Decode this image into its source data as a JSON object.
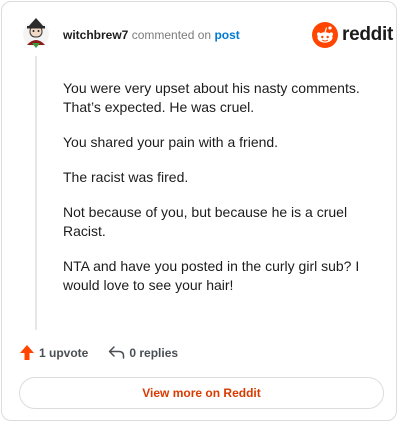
{
  "header": {
    "username": "witchbrew7",
    "action_text": "commented on",
    "post_link": "post",
    "brand": "reddit"
  },
  "comment": {
    "paragraphs": [
      "You were very upset about his nasty comments. That’s expected. He was cruel.",
      "You shared your pain with a friend.",
      "The racist was fired.",
      "Not because of you, but because he is a cruel Racist.",
      "NTA and have you posted in the curly girl sub? I would love to see your hair!"
    ]
  },
  "actions": {
    "upvotes": "1 upvote",
    "replies": "0 replies"
  },
  "footer": {
    "view_more": "View more on Reddit"
  },
  "colors": {
    "brand_orange": "#ff4500",
    "link_blue": "#0079d3",
    "view_more_text": "#d93a00"
  },
  "icons": [
    "avatar-icon",
    "reddit-logo-icon",
    "upvote-arrow-icon",
    "reply-arrow-icon"
  ]
}
